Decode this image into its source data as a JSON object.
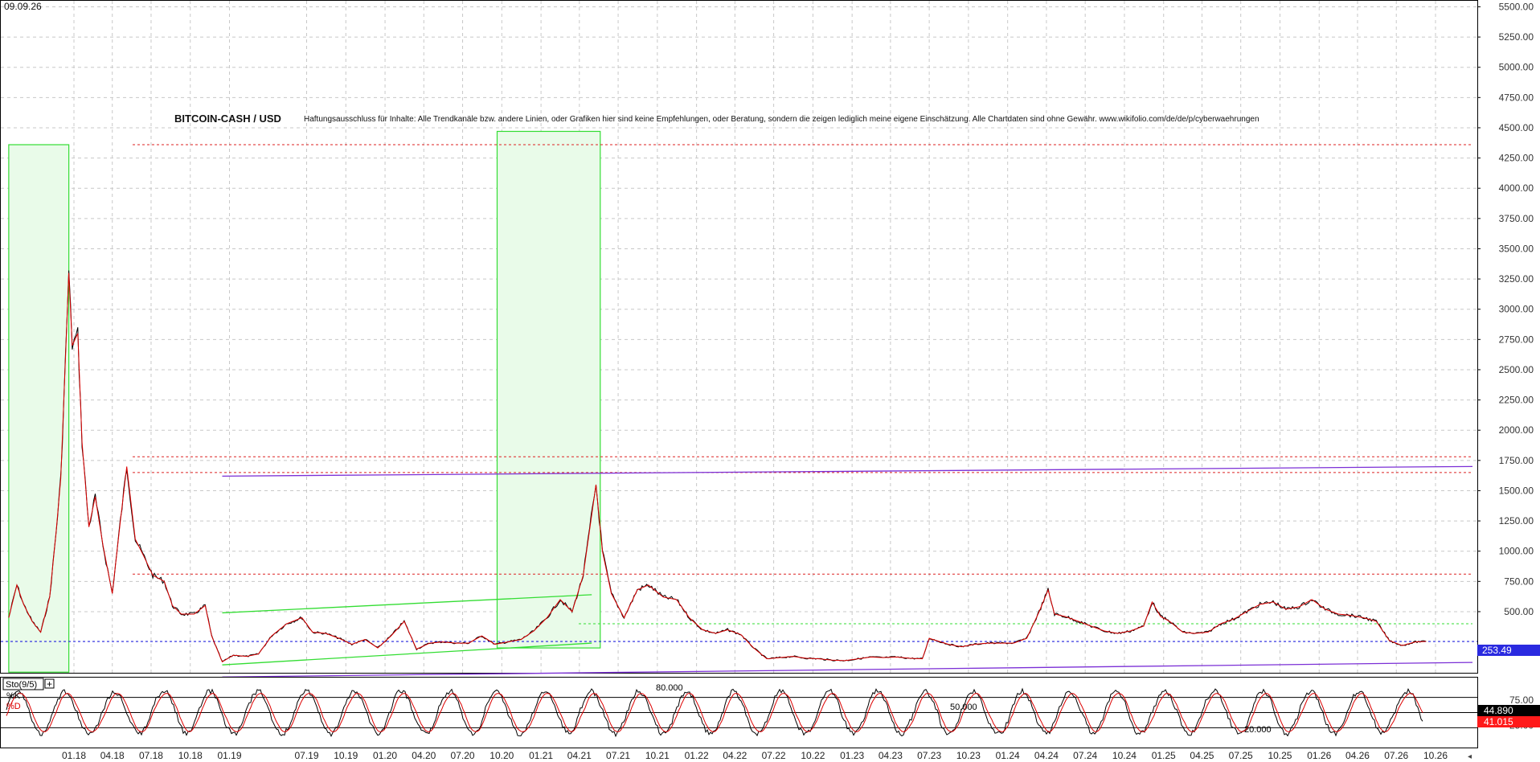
{
  "header": {
    "date": "09.09.26",
    "title": "BITCOIN-CASH / USD",
    "disclaimer": "Haftungsausschluss für Inhalte: Alle Trendkanäle bzw. andere Linien, oder Grafiken hier sind keine Empfehlungen, oder Beratung, sondern die zeigen lediglich meine eigene Einschätzung. Alle Chartdaten sind ohne Gewähr.  www.wikifolio.com/de/de/p/cyberwaehrungen"
  },
  "colors": {
    "price": "#000000",
    "price_ma": "#dd0000",
    "zone_fill": "#e9fbe9",
    "zone_stroke": "#33dd33",
    "trend_purple": "#7b2fd6",
    "trend_green": "#33dd33",
    "level_red": "#dd2222",
    "level_blue": "#2222dd",
    "last_price_bg": "#2a2ae0",
    "stoch_d_bg": "#ff1a1a"
  },
  "chart_data": [
    {
      "type": "line",
      "title": "BITCOIN-CASH / USD",
      "x_ticks": [
        "01.18",
        "04.18",
        "07.18",
        "10.18",
        "01.19",
        "07.19",
        "10.19",
        "01.20",
        "04.20",
        "07.20",
        "10.20",
        "01.21",
        "04.21",
        "07.21",
        "10.21",
        "01.22",
        "04.22",
        "07.22",
        "10.22",
        "01.23",
        "04.23",
        "07.23",
        "10.23",
        "01.24",
        "04.24",
        "07.24",
        "10.24",
        "01.25",
        "04.25",
        "07.25",
        "10.25",
        "01.26",
        "04.26",
        "07.26",
        "10.26"
      ],
      "y_ticks": [
        500,
        750,
        1000,
        1250,
        1500,
        1750,
        2000,
        2250,
        2500,
        2750,
        3000,
        3250,
        3500,
        3750,
        4000,
        4250,
        4500,
        4750,
        5000,
        5250,
        5500
      ],
      "ylim": [
        0,
        5600
      ],
      "grid": true,
      "series": [
        {
          "values": [
            {
              "x": "2017-08-01",
              "y": 450
            },
            {
              "x": "2017-08-20",
              "y": 720
            },
            {
              "x": "2017-09-05",
              "y": 560
            },
            {
              "x": "2017-09-25",
              "y": 420
            },
            {
              "x": "2017-10-15",
              "y": 330
            },
            {
              "x": "2017-11-05",
              "y": 620
            },
            {
              "x": "2017-11-20",
              "y": 1150
            },
            {
              "x": "2017-12-01",
              "y": 1600
            },
            {
              "x": "2017-12-20",
              "y": 3300
            },
            {
              "x": "2017-12-28",
              "y": 2700
            },
            {
              "x": "2018-01-10",
              "y": 2800
            },
            {
              "x": "2018-01-20",
              "y": 1900
            },
            {
              "x": "2018-02-05",
              "y": 1200
            },
            {
              "x": "2018-02-20",
              "y": 1450
            },
            {
              "x": "2018-03-10",
              "y": 1050
            },
            {
              "x": "2018-04-01",
              "y": 650
            },
            {
              "x": "2018-04-20",
              "y": 1250
            },
            {
              "x": "2018-05-05",
              "y": 1700
            },
            {
              "x": "2018-05-25",
              "y": 1100
            },
            {
              "x": "2018-06-15",
              "y": 950
            },
            {
              "x": "2018-07-05",
              "y": 800
            },
            {
              "x": "2018-08-01",
              "y": 750
            },
            {
              "x": "2018-08-20",
              "y": 550
            },
            {
              "x": "2018-09-10",
              "y": 480
            },
            {
              "x": "2018-10-10",
              "y": 480
            },
            {
              "x": "2018-11-05",
              "y": 550
            },
            {
              "x": "2018-11-20",
              "y": 300
            },
            {
              "x": "2018-12-15",
              "y": 85
            },
            {
              "x": "2019-01-10",
              "y": 140
            },
            {
              "x": "2019-02-10",
              "y": 130
            },
            {
              "x": "2019-03-10",
              "y": 150
            },
            {
              "x": "2019-04-10",
              "y": 300
            },
            {
              "x": "2019-05-15",
              "y": 400
            },
            {
              "x": "2019-06-20",
              "y": 450
            },
            {
              "x": "2019-07-15",
              "y": 330
            },
            {
              "x": "2019-08-15",
              "y": 320
            },
            {
              "x": "2019-09-15",
              "y": 280
            },
            {
              "x": "2019-10-15",
              "y": 230
            },
            {
              "x": "2019-11-15",
              "y": 270
            },
            {
              "x": "2019-12-15",
              "y": 200
            },
            {
              "x": "2020-01-15",
              "y": 300
            },
            {
              "x": "2020-02-15",
              "y": 420
            },
            {
              "x": "2020-03-15",
              "y": 190
            },
            {
              "x": "2020-04-15",
              "y": 240
            },
            {
              "x": "2020-05-15",
              "y": 250
            },
            {
              "x": "2020-06-15",
              "y": 240
            },
            {
              "x": "2020-07-15",
              "y": 240
            },
            {
              "x": "2020-08-15",
              "y": 300
            },
            {
              "x": "2020-09-15",
              "y": 230
            },
            {
              "x": "2020-10-15",
              "y": 250
            },
            {
              "x": "2020-11-15",
              "y": 270
            },
            {
              "x": "2020-12-15",
              "y": 340
            },
            {
              "x": "2021-01-15",
              "y": 450
            },
            {
              "x": "2021-02-15",
              "y": 600
            },
            {
              "x": "2021-03-15",
              "y": 500
            },
            {
              "x": "2021-04-10",
              "y": 800
            },
            {
              "x": "2021-05-10",
              "y": 1550
            },
            {
              "x": "2021-05-25",
              "y": 1000
            },
            {
              "x": "2021-06-15",
              "y": 650
            },
            {
              "x": "2021-07-15",
              "y": 450
            },
            {
              "x": "2021-08-15",
              "y": 680
            },
            {
              "x": "2021-09-10",
              "y": 720
            },
            {
              "x": "2021-10-15",
              "y": 620
            },
            {
              "x": "2021-11-15",
              "y": 600
            },
            {
              "x": "2021-12-15",
              "y": 450
            },
            {
              "x": "2022-01-15",
              "y": 350
            },
            {
              "x": "2022-02-15",
              "y": 320
            },
            {
              "x": "2022-03-15",
              "y": 350
            },
            {
              "x": "2022-04-15",
              "y": 310
            },
            {
              "x": "2022-05-15",
              "y": 200
            },
            {
              "x": "2022-06-15",
              "y": 110
            },
            {
              "x": "2022-07-15",
              "y": 120
            },
            {
              "x": "2022-08-15",
              "y": 130
            },
            {
              "x": "2022-09-15",
              "y": 115
            },
            {
              "x": "2022-10-15",
              "y": 110
            },
            {
              "x": "2022-11-15",
              "y": 100
            },
            {
              "x": "2022-12-15",
              "y": 95
            },
            {
              "x": "2023-01-15",
              "y": 110
            },
            {
              "x": "2023-02-15",
              "y": 125
            },
            {
              "x": "2023-03-15",
              "y": 120
            },
            {
              "x": "2023-04-15",
              "y": 125
            },
            {
              "x": "2023-05-15",
              "y": 115
            },
            {
              "x": "2023-06-15",
              "y": 110
            },
            {
              "x": "2023-07-01",
              "y": 280
            },
            {
              "x": "2023-08-15",
              "y": 230
            },
            {
              "x": "2023-09-15",
              "y": 210
            },
            {
              "x": "2023-10-15",
              "y": 230
            },
            {
              "x": "2023-11-15",
              "y": 240
            },
            {
              "x": "2023-12-15",
              "y": 240
            },
            {
              "x": "2024-01-15",
              "y": 240
            },
            {
              "x": "2024-02-15",
              "y": 280
            },
            {
              "x": "2024-03-15",
              "y": 500
            },
            {
              "x": "2024-04-05",
              "y": 680
            },
            {
              "x": "2024-04-20",
              "y": 480
            },
            {
              "x": "2024-05-15",
              "y": 460
            },
            {
              "x": "2024-06-15",
              "y": 420
            },
            {
              "x": "2024-07-15",
              "y": 380
            },
            {
              "x": "2024-08-15",
              "y": 340
            },
            {
              "x": "2024-09-15",
              "y": 320
            },
            {
              "x": "2024-10-15",
              "y": 340
            },
            {
              "x": "2024-11-15",
              "y": 380
            },
            {
              "x": "2024-12-05",
              "y": 580
            },
            {
              "x": "2024-12-25",
              "y": 460
            },
            {
              "x": "2025-01-15",
              "y": 420
            },
            {
              "x": "2025-02-15",
              "y": 330
            },
            {
              "x": "2025-03-15",
              "y": 320
            },
            {
              "x": "2025-04-15",
              "y": 330
            },
            {
              "x": "2025-05-15",
              "y": 400
            },
            {
              "x": "2025-06-15",
              "y": 440
            },
            {
              "x": "2025-07-15",
              "y": 500
            },
            {
              "x": "2025-08-15",
              "y": 560
            },
            {
              "x": "2025-09-15",
              "y": 580
            },
            {
              "x": "2025-10-15",
              "y": 520
            },
            {
              "x": "2025-11-15",
              "y": 540
            },
            {
              "x": "2025-12-15",
              "y": 600
            },
            {
              "x": "2026-01-15",
              "y": 520
            },
            {
              "x": "2026-02-15",
              "y": 480
            },
            {
              "x": "2026-03-15",
              "y": 470
            },
            {
              "x": "2026-04-15",
              "y": 450
            },
            {
              "x": "2026-05-15",
              "y": 420
            },
            {
              "x": "2026-06-15",
              "y": 260
            },
            {
              "x": "2026-07-15",
              "y": 220
            },
            {
              "x": "2026-08-15",
              "y": 250
            },
            {
              "x": "2026-09-09",
              "y": 253.49
            }
          ]
        }
      ],
      "levels": {
        "red_dashed": [
          4360,
          1780,
          1650,
          810
        ],
        "green_dashed": [
          400
        ],
        "blue_dashed": [
          253.49
        ]
      },
      "trend_lines": [
        {
          "color": "purple",
          "from": {
            "x": "2018-12-15",
            "y": 1620
          },
          "to": {
            "x": "2026-12-31",
            "y": 1700
          }
        },
        {
          "color": "purple",
          "from": {
            "x": "2018-12-15",
            "y": -40
          },
          "to": {
            "x": "2026-12-31",
            "y": 80
          }
        },
        {
          "color": "green",
          "from": {
            "x": "2018-12-15",
            "y": 490
          },
          "to": {
            "x": "2021-04-30",
            "y": 640
          }
        },
        {
          "color": "green",
          "from": {
            "x": "2018-12-15",
            "y": 60
          },
          "to": {
            "x": "2021-04-30",
            "y": 240
          }
        }
      ],
      "zones": [
        {
          "from": "2017-08-01",
          "to": "2017-12-20",
          "y_low": 0,
          "y_high": 4360
        },
        {
          "from": "2020-09-20",
          "to": "2021-05-20",
          "y_low": 200,
          "y_high": 4470
        }
      ],
      "last_price_label": "253.49"
    },
    {
      "type": "line",
      "title": "Sto(9/5)",
      "series_labels": [
        "%K",
        "%D"
      ],
      "y_ticks": [
        25,
        50,
        75
      ],
      "ylim": [
        0,
        100
      ],
      "levels": [
        20,
        50,
        80
      ],
      "level_labels": [
        "20.000",
        "50.000",
        "80.000"
      ],
      "last_values": {
        "k": "44.890",
        "d": "41.015"
      }
    }
  ]
}
